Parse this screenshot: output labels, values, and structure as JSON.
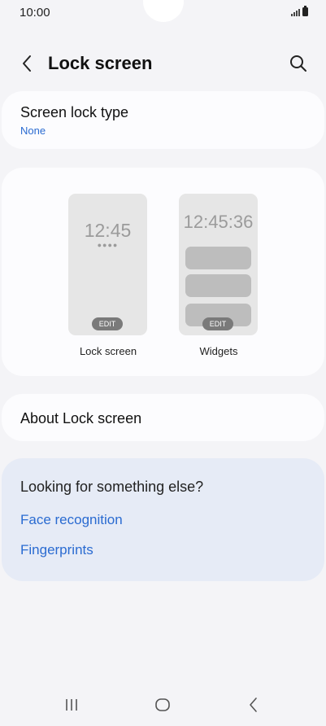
{
  "status": {
    "time": "10:00"
  },
  "header": {
    "title": "Lock screen"
  },
  "lock_type": {
    "title": "Screen lock type",
    "value": "None"
  },
  "previews": {
    "lock": {
      "clock": "12:45",
      "dots": "●●●●",
      "edit": "EDIT",
      "label": "Lock screen"
    },
    "widgets": {
      "clock": "12:45:36",
      "edit": "EDIT",
      "label": "Widgets"
    }
  },
  "about": {
    "label": "About Lock screen"
  },
  "looking": {
    "title": "Looking for something else?",
    "links": [
      "Face recognition",
      "Fingerprints"
    ]
  },
  "icons": {
    "back": "back-arrow-icon",
    "search": "search-icon",
    "recents": "recents-icon",
    "home": "home-icon",
    "nav_back": "nav-back-icon"
  },
  "colors": {
    "link": "#2a6bd1",
    "background": "#f4f4f7",
    "highlight_card": "#e6ebf6"
  }
}
